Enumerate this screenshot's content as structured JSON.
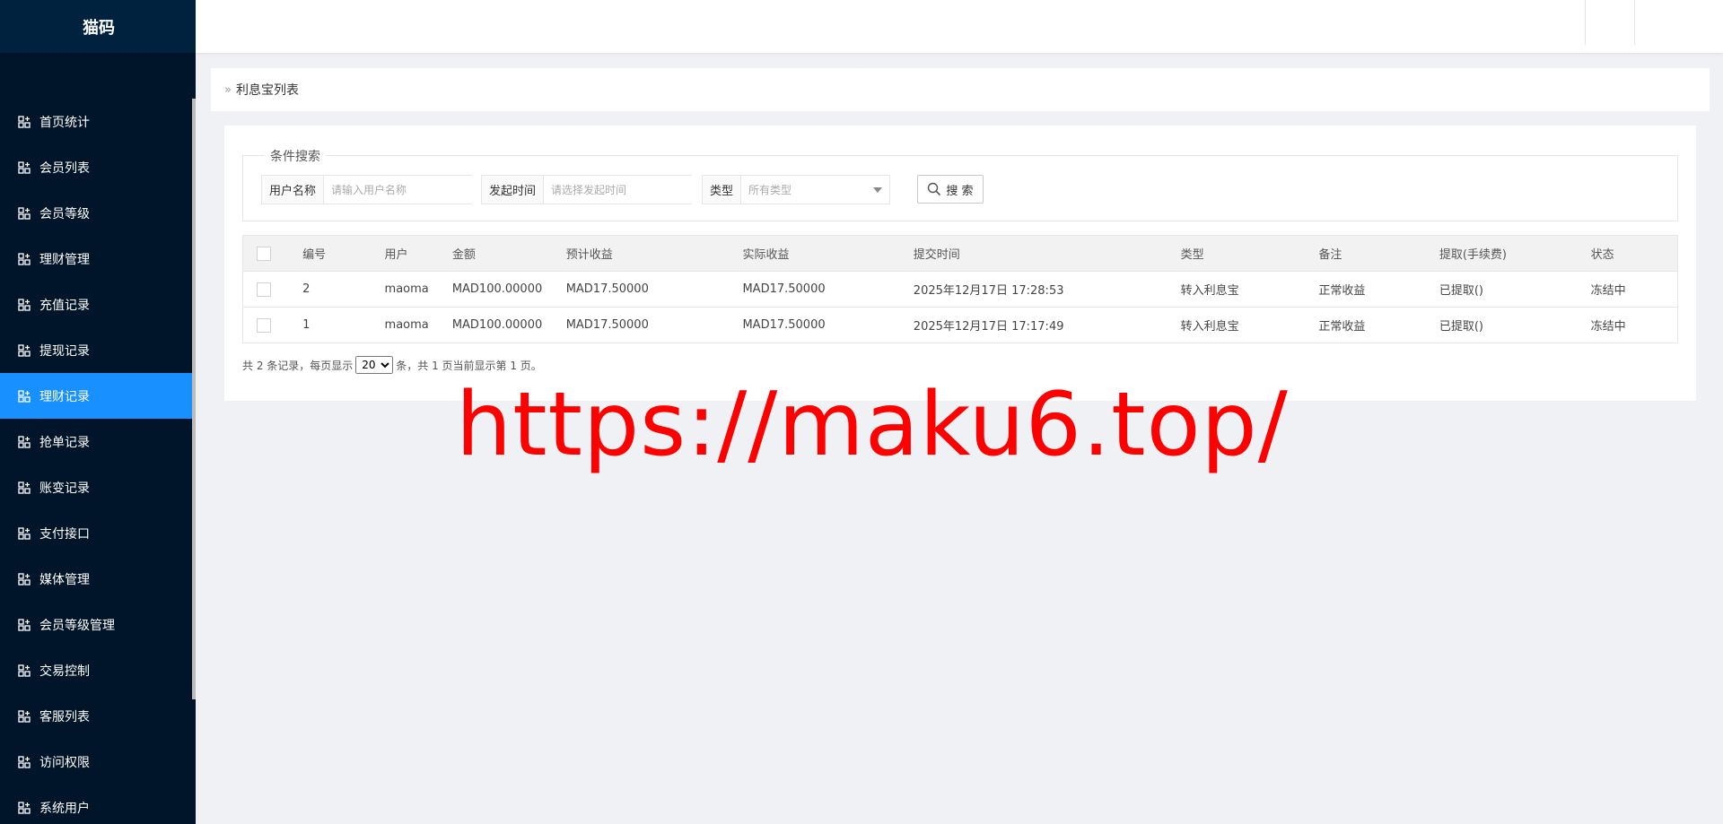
{
  "app": {
    "title": "猫码"
  },
  "sidebar": {
    "items": [
      {
        "label": "首页统计",
        "active": false
      },
      {
        "label": "会员列表",
        "active": false
      },
      {
        "label": "会员等级",
        "active": false
      },
      {
        "label": "理财管理",
        "active": false
      },
      {
        "label": "充值记录",
        "active": false
      },
      {
        "label": "提现记录",
        "active": false
      },
      {
        "label": "理财记录",
        "active": true
      },
      {
        "label": "抢单记录",
        "active": false
      },
      {
        "label": "账变记录",
        "active": false
      },
      {
        "label": "支付接口",
        "active": false
      },
      {
        "label": "媒体管理",
        "active": false
      },
      {
        "label": "会员等级管理",
        "active": false
      },
      {
        "label": "交易控制",
        "active": false
      },
      {
        "label": "客服列表",
        "active": false
      },
      {
        "label": "访问权限",
        "active": false
      },
      {
        "label": "系统用户",
        "active": false
      }
    ],
    "active_color": "#1890ff",
    "bg_color": "#001529"
  },
  "breadcrumb": {
    "arrow": "»",
    "title": "利息宝列表"
  },
  "search": {
    "legend": "条件搜索",
    "username_label": "用户名称",
    "username_placeholder": "请输入用户名称",
    "time_label": "发起时间",
    "time_placeholder": "请选择发起时间",
    "type_label": "类型",
    "type_selected": "所有类型",
    "button_label": "搜 索"
  },
  "table": {
    "headers": [
      "编号",
      "用户",
      "金额",
      "预计收益",
      "实际收益",
      "提交时间",
      "类型",
      "备注",
      "提取(手续费)",
      "状态"
    ],
    "rows": [
      [
        "2",
        "maoma",
        "MAD100.00000",
        "MAD17.50000",
        "MAD17.50000",
        "2025年12月17日 17:28:53",
        "转入利息宝",
        "正常收益",
        "已提取()",
        "冻结中"
      ],
      [
        "1",
        "maoma",
        "MAD100.00000",
        "MAD17.50000",
        "MAD17.50000",
        "2025年12月17日 17:17:49",
        "转入利息宝",
        "正常收益",
        "已提取()",
        "冻结中"
      ]
    ]
  },
  "pager": {
    "prefix": "共 2 条记录，每页显示",
    "page_size": "20",
    "suffix": "条，共 1 页当前显示第 1 页。"
  },
  "watermark": {
    "text": "https://maku6.top/",
    "color": "#ff0000"
  }
}
